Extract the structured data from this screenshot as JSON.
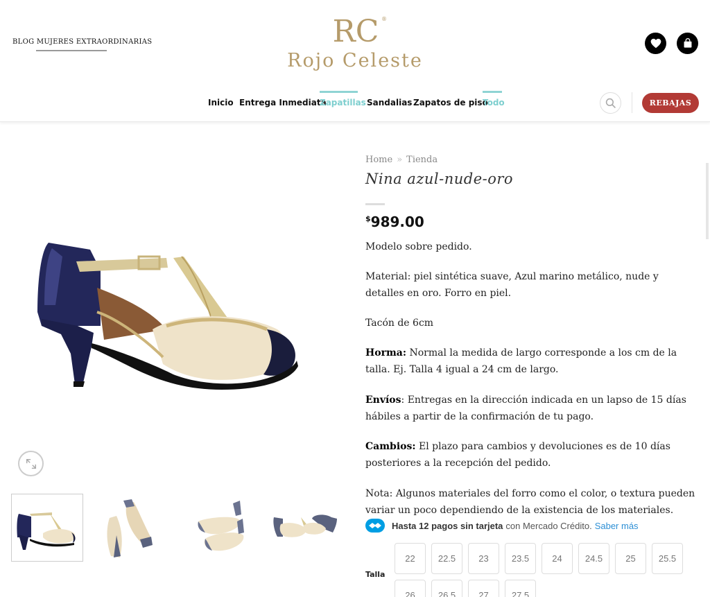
{
  "header": {
    "blog_link": "BLOG MUJERES EXTRAORDINARIAS",
    "logo_initials": "RC",
    "logo_name": "Rojo Celeste",
    "sale_button": "REBAJAS",
    "icons": {
      "wishlist": "heart-icon",
      "cart": "shopping-bag-icon",
      "search": "search-icon"
    }
  },
  "nav": {
    "items": [
      {
        "label": "Inicio"
      },
      {
        "label": "Entrega Inmediata"
      },
      {
        "label": "Zapatillas"
      },
      {
        "label": "Sandalias"
      },
      {
        "label": "Zapatos de piso"
      },
      {
        "label": "Todo"
      }
    ]
  },
  "product": {
    "breadcrumb": {
      "home": "Home",
      "separator": "»",
      "shop": "Tienda"
    },
    "title": "Nina azul-nude-oro",
    "currency": "$",
    "price": "989.00",
    "desc": {
      "p1": "Modelo sobre pedido.",
      "p2": "Material: piel sintética suave, Azul marino metálico, nude y detalles en oro. Forro en piel.",
      "p3": "Tacón de 6cm",
      "p4_label": "Horma:",
      "p4_text": " Normal la medida de largo corresponde a los cm de la talla. Ej. Talla 4 igual a 24 cm de largo.",
      "p5_label": "Envíos",
      "p5_text": ": Entregas en la dirección indicada en un lapso de 15 días hábiles a partir de la confirmación de tu pago.",
      "p6_label": "Cambios:",
      "p6_text": " El plazo para cambios y devoluciones es de 10 días posteriores a la recepción del pedido.",
      "p7": "Nota: Algunos materiales del forro como el color, o textura pueden variar un poco dependiendo de la existencia de los materiales."
    },
    "mercado_pago": {
      "bold": "Hasta 12 pagos sin tarjeta",
      "normal": "con Mercado Crédito.",
      "link": "Saber más"
    },
    "size_label": "Talla",
    "sizes": [
      "22",
      "22.5",
      "23",
      "23.5",
      "24",
      "24.5",
      "25",
      "25.5",
      "26",
      "26.5",
      "27",
      "27.5"
    ]
  },
  "colors": {
    "accent_teal": "#7ecfcf",
    "sale_red": "#b23a35",
    "logo_gold": "#b59b6a",
    "link_blue": "#2d8fd5"
  }
}
